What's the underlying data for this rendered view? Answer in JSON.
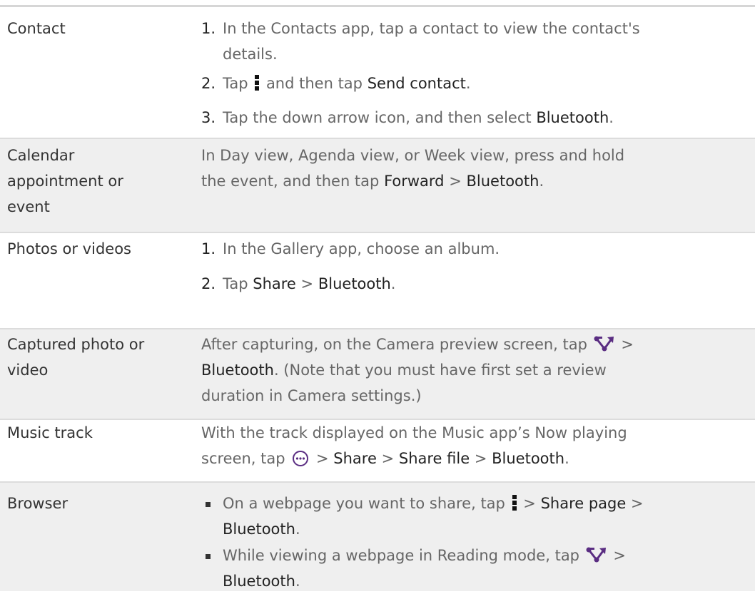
{
  "rows": [
    {
      "label": "Contact",
      "steps": [
        {
          "num": "1.",
          "line1": "In the Contacts app, tap a contact to view the contact's",
          "line2": "details."
        },
        {
          "num": "2.",
          "pre": "Tap",
          "mid": "and then tap",
          "bold": "Send contact",
          "post": "."
        },
        {
          "num": "3.",
          "pre": "Tap the down arrow icon, and then select",
          "bold": "Bluetooth",
          "post": "."
        }
      ]
    },
    {
      "label_lines": [
        "Calendar",
        "appointment or",
        "event"
      ],
      "line1": "In Day view, Agenda view, or Week view, press and hold",
      "line2_pre": "the event, and then tap",
      "bold1": "Forward",
      "sep": ">",
      "bold2": "Bluetooth",
      "post": "."
    },
    {
      "label": "Photos or videos",
      "steps": [
        {
          "num": "1.",
          "text": "In the Gallery app, choose an album."
        },
        {
          "num": "2.",
          "pre": "Tap",
          "bold1": "Share",
          "sep": ">",
          "bold2": "Bluetooth",
          "post": "."
        }
      ]
    },
    {
      "label_lines": [
        "Captured photo or",
        "video"
      ],
      "line1_pre": "After capturing, on the Camera preview screen, tap",
      "line1_sep": ">",
      "line2_bold": "Bluetooth",
      "line2_post": ". (Note that you must have first set a review",
      "line3": "duration in Camera settings.)"
    },
    {
      "label": "Music track",
      "line1": "With the track displayed on the Music app’s Now playing",
      "line2_pre": "screen, tap",
      "sep": ">",
      "bold1": "Share",
      "bold2": "Share file",
      "bold3": "Bluetooth",
      "post": "."
    },
    {
      "label": "Browser",
      "bullets": [
        {
          "pre": "On a webpage you want to share, tap",
          "sep": ">",
          "bold1": "Share page",
          "bold2": "Bluetooth",
          "post": "."
        },
        {
          "pre": "While viewing a webpage in Reading mode, tap",
          "sep": ">",
          "bold2": "Bluetooth",
          "post": "."
        }
      ]
    }
  ],
  "colors": {
    "row_shade": "#efefef",
    "separator": "#dcdcdc",
    "label_text": "#333333",
    "body_text": "#666666",
    "emphasis_text": "#222222",
    "icon_purple": "#5a2d82"
  },
  "icons": {
    "vertical_dots": "more-vertical-icon",
    "share": "share-icon",
    "more_circle": "more-horizontal-circle-icon"
  }
}
